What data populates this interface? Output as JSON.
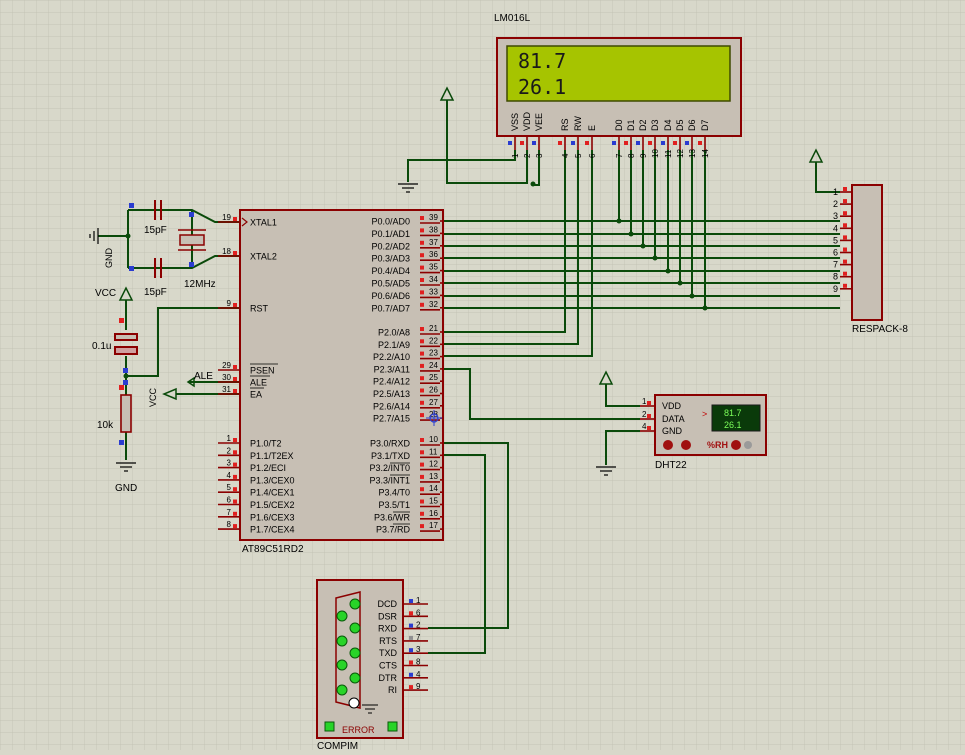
{
  "lcd": {
    "title": "LM016L",
    "line1": "81.7",
    "line2": "26.1",
    "pins": [
      {
        "name": "VSS",
        "num": "1"
      },
      {
        "name": "VDD",
        "num": "2"
      },
      {
        "name": "VEE",
        "num": "3"
      },
      {
        "name": "RS",
        "num": "4"
      },
      {
        "name": "RW",
        "num": "5"
      },
      {
        "name": "E",
        "num": "6"
      },
      {
        "name": "D0",
        "num": "7"
      },
      {
        "name": "D1",
        "num": "8"
      },
      {
        "name": "D2",
        "num": "9"
      },
      {
        "name": "D3",
        "num": "10"
      },
      {
        "name": "D4",
        "num": "11"
      },
      {
        "name": "D5",
        "num": "12"
      },
      {
        "name": "D6",
        "num": "13"
      },
      {
        "name": "D7",
        "num": "14"
      }
    ]
  },
  "mcu": {
    "title": "AT89C51RD2",
    "left_top": [
      {
        "name": "XTAL1",
        "num": "19"
      },
      {
        "name": "XTAL2",
        "num": "18"
      },
      {
        "name": "RST",
        "num": "9"
      }
    ],
    "left_ctrl": [
      {
        "name": "PSEN",
        "num": "29"
      },
      {
        "name": "ALE",
        "num": "30"
      },
      {
        "name": "EA",
        "num": "31"
      }
    ],
    "p1": [
      {
        "name": "P1.0/T2",
        "num": "1"
      },
      {
        "name": "P1.1/T2EX",
        "num": "2"
      },
      {
        "name": "P1.2/ECI",
        "num": "3"
      },
      {
        "name": "P1.3/CEX0",
        "num": "4"
      },
      {
        "name": "P1.4/CEX1",
        "num": "5"
      },
      {
        "name": "P1.5/CEX2",
        "num": "6"
      },
      {
        "name": "P1.6/CEX3",
        "num": "7"
      },
      {
        "name": "P1.7/CEX4",
        "num": "8"
      }
    ],
    "p0": [
      {
        "name": "P0.0/AD0",
        "num": "39"
      },
      {
        "name": "P0.1/AD1",
        "num": "38"
      },
      {
        "name": "P0.2/AD2",
        "num": "37"
      },
      {
        "name": "P0.3/AD3",
        "num": "36"
      },
      {
        "name": "P0.4/AD4",
        "num": "35"
      },
      {
        "name": "P0.5/AD5",
        "num": "34"
      },
      {
        "name": "P0.6/AD6",
        "num": "33"
      },
      {
        "name": "P0.7/AD7",
        "num": "32"
      }
    ],
    "p2": [
      {
        "name": "P2.0/A8",
        "num": "21"
      },
      {
        "name": "P2.1/A9",
        "num": "22"
      },
      {
        "name": "P2.2/A10",
        "num": "23"
      },
      {
        "name": "P2.3/A11",
        "num": "24"
      },
      {
        "name": "P2.4/A12",
        "num": "25"
      },
      {
        "name": "P2.5/A13",
        "num": "26"
      },
      {
        "name": "P2.6/A14",
        "num": "27"
      },
      {
        "name": "P2.7/A15",
        "num": "28"
      }
    ],
    "p3": [
      {
        "name": "P3.0/RXD",
        "num": "10"
      },
      {
        "name": "P3.1/TXD",
        "num": "11"
      },
      {
        "name": "P3.2/INT0",
        "num": "12"
      },
      {
        "name": "P3.3/INT1",
        "num": "13"
      },
      {
        "name": "P3.4/T0",
        "num": "14"
      },
      {
        "name": "P3.5/T1",
        "num": "15"
      },
      {
        "name": "P3.6/WR",
        "num": "16"
      },
      {
        "name": "P3.7/RD",
        "num": "17"
      }
    ]
  },
  "respack": {
    "title": "RESPACK-8",
    "pins": [
      "1",
      "2",
      "3",
      "4",
      "5",
      "6",
      "7",
      "8",
      "9"
    ]
  },
  "dht": {
    "title": "DHT22",
    "pins": [
      {
        "name": "VDD",
        "num": "1"
      },
      {
        "name": "DATA",
        "num": "2"
      },
      {
        "name": "GND",
        "num": "4"
      }
    ],
    "temp": "81.7",
    "hum": "26.1",
    "arrow": ">",
    "unit": "%RH"
  },
  "compim": {
    "title": "COMPIM",
    "error": "ERROR",
    "pins": [
      {
        "name": "DCD",
        "num": "1"
      },
      {
        "name": "DSR",
        "num": "6"
      },
      {
        "name": "RXD",
        "num": "2"
      },
      {
        "name": "RTS",
        "num": "7"
      },
      {
        "name": "TXD",
        "num": "3"
      },
      {
        "name": "CTS",
        "num": "8"
      },
      {
        "name": "DTR",
        "num": "4"
      },
      {
        "name": "RI",
        "num": "9"
      }
    ]
  },
  "parts": {
    "cap1": "15pF",
    "cap2": "15pF",
    "crystal": "12MHz",
    "cap3": "0.1u",
    "res": "10k",
    "vcc1": "VCC",
    "vcc2": "VCC",
    "gnd1": "GND",
    "gnd2": "GND",
    "ale": "ALE"
  },
  "colors": {
    "wire": "#0a4a0a",
    "component_border": "#8b0000",
    "component_fill": "#c7bfb4",
    "lcd_screen": "#a6c400",
    "grid_background": "#d8d8ca"
  }
}
